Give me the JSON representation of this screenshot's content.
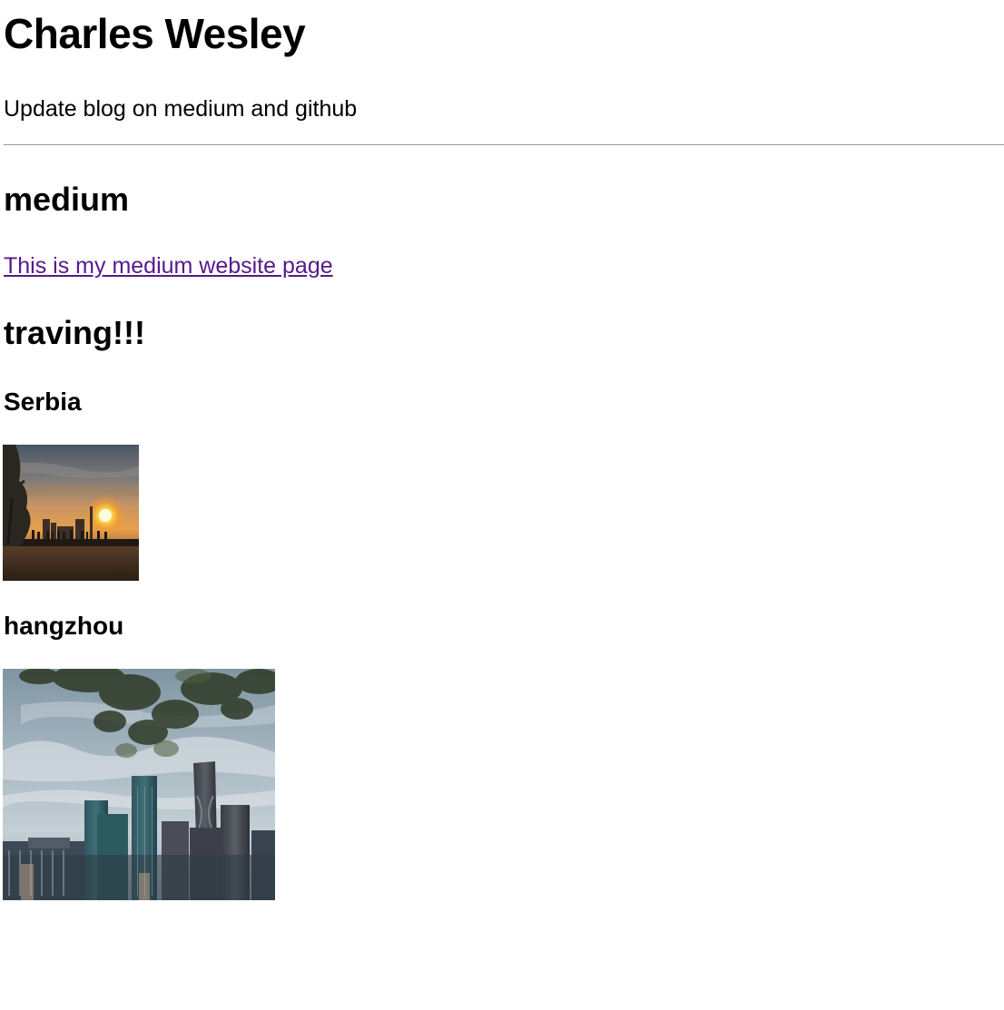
{
  "header": {
    "title": "Charles Wesley",
    "tagline": "Update blog on medium and github"
  },
  "medium_section": {
    "heading": "medium",
    "link_text": "This is my medium website page"
  },
  "travel_section": {
    "heading": "traving!!!",
    "places": [
      {
        "name": "Serbia",
        "photo_icon": "sunset-photo"
      },
      {
        "name": "hangzhou",
        "photo_icon": "city-skyline-photo"
      }
    ]
  },
  "colors": {
    "text": "#000000",
    "link_visited": "#551a8b",
    "divider": "#9a9a9a",
    "background": "#ffffff"
  }
}
